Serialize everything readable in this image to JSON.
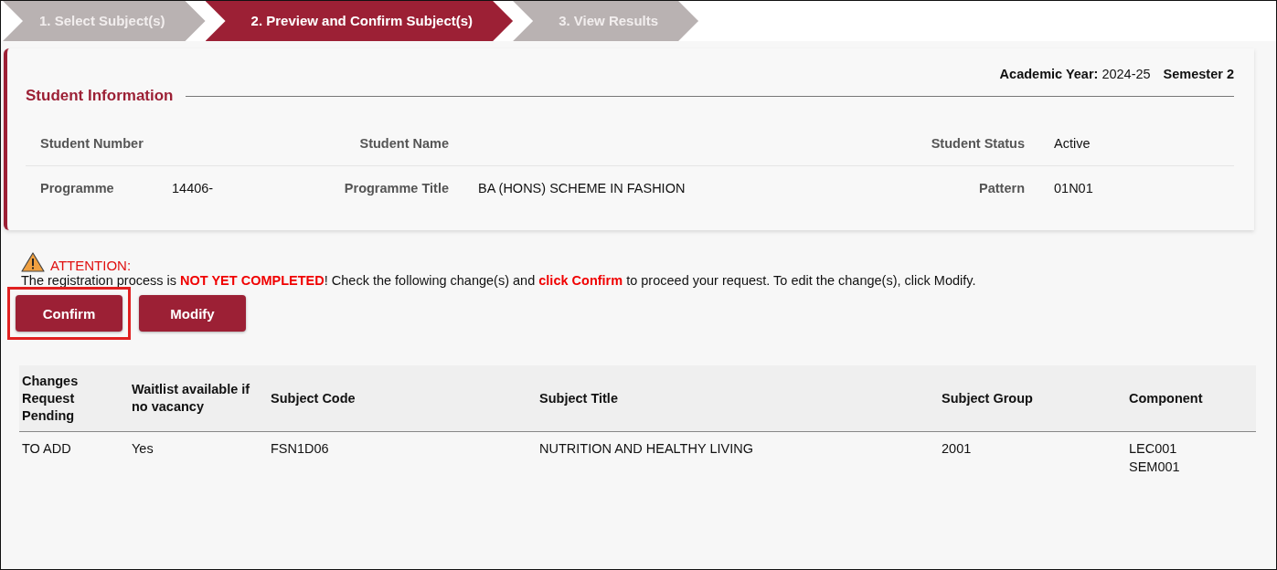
{
  "steps": [
    {
      "label": "1. Select Subject(s)",
      "selected": false
    },
    {
      "label": "2. Preview and Confirm Subject(s)",
      "selected": true
    },
    {
      "label": "3. View Results",
      "selected": false
    }
  ],
  "term": {
    "year_label": "Academic Year:",
    "year": "2024-25",
    "semester": "Semester 2"
  },
  "student_info": {
    "title": "Student Information",
    "rows": [
      [
        {
          "label": "Student Number"
        },
        {
          "label": "Student Name"
        },
        {
          "label": "Student Status",
          "value": "Active"
        }
      ],
      [
        {
          "label": "Programme",
          "value": "14406-"
        },
        {
          "label": "Programme Title",
          "value": "BA (HONS) SCHEME IN FASHION"
        },
        {
          "label": "Pattern",
          "value": "01N01"
        }
      ]
    ]
  },
  "attention": {
    "title": "ATTENTION:",
    "message": "The registration process is **NOT YET COMPLETED**! Check the following change(s) and **click Confirm** to proceed your request. To edit the change(s), click Modify."
  },
  "buttons": [
    {
      "label": "Confirm",
      "highlighted": true
    },
    {
      "label": "Modify",
      "highlighted": false
    }
  ],
  "table": {
    "columns": [
      "Changes Request Pending",
      "Waitlist available if no vacancy",
      "Subject Code",
      "Subject Title",
      "Subject Group",
      "Component"
    ],
    "rows": [
      [
        "TO ADD",
        "Yes",
        "FSN1D06",
        "NUTRITION AND HEALTHY LIVING",
        "2001",
        "LEC001\nSEM001"
      ]
    ]
  }
}
